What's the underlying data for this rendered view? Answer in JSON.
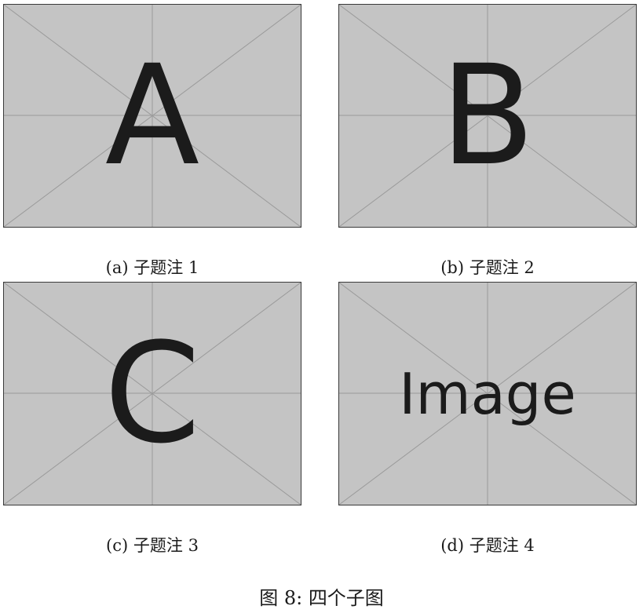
{
  "subfigures": [
    {
      "placeholder_text": "A",
      "label": "(a)",
      "caption": "子题注 1"
    },
    {
      "placeholder_text": "B",
      "label": "(b)",
      "caption": "子题注 2"
    },
    {
      "placeholder_text": "C",
      "label": "(c)",
      "caption": "子题注 3"
    },
    {
      "placeholder_text": "Image",
      "label": "(d)",
      "caption": "子题注 4"
    }
  ],
  "figure_caption": {
    "prefix": "图 8:",
    "text": "四个子图"
  }
}
